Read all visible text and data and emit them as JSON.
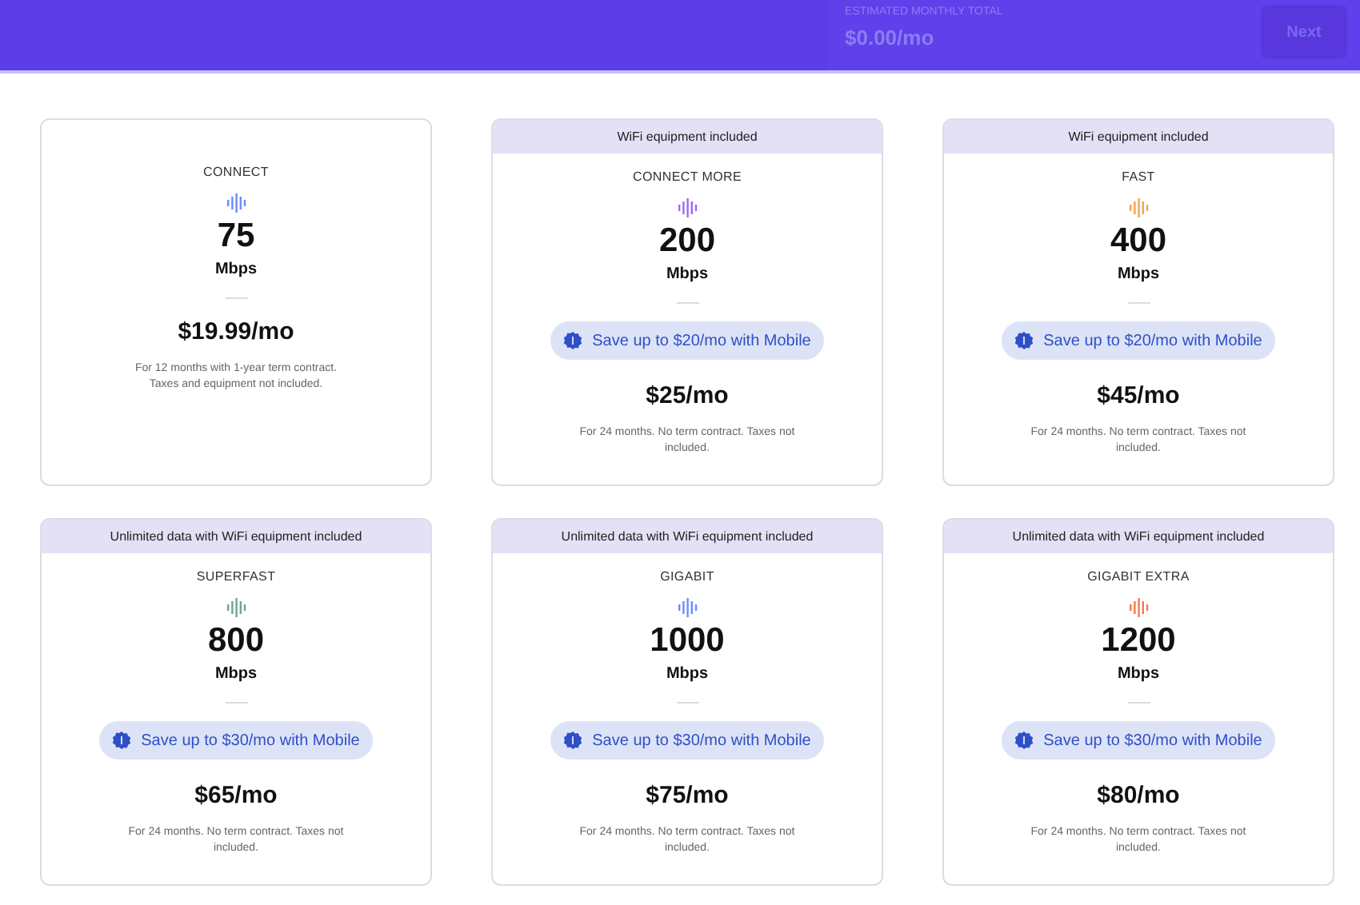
{
  "header": {
    "total_label": "ESTIMATED MONTHLY TOTAL",
    "total": "$0.00/mo",
    "next_button": {
      "label": "Next",
      "disabled": true
    }
  },
  "plans": [
    {
      "name": "CONNECT",
      "color": "#6b8cff",
      "speed": "75",
      "unit": "Mbps",
      "price": "$19.99/mo",
      "note": "For 12 months with 1-year term contract. Taxes and equipment not included."
    },
    {
      "banner": "WiFi equipment included",
      "name": "CONNECT MORE",
      "color": "#9a6cf0",
      "speed": "200",
      "unit": "Mbps",
      "promo": "Save up to $20/mo with Mobile",
      "price": "$25/mo",
      "note": "For 24 months. No term contract. Taxes not included."
    },
    {
      "banner": "WiFi equipment included",
      "name": "FAST",
      "color": "#f0a850",
      "speed": "400",
      "unit": "Mbps",
      "promo": "Save up to $20/mo with Mobile",
      "price": "$45/mo",
      "note": "For 24 months. No term contract. Taxes not included."
    },
    {
      "banner": "Unlimited data with WiFi equipment included",
      "name": "SUPERFAST",
      "color": "#6aa888",
      "speed": "800",
      "unit": "Mbps",
      "promo": "Save up to $30/mo with Mobile",
      "price": "$65/mo",
      "note": "For 24 months. No term contract. Taxes not included."
    },
    {
      "banner": "Unlimited data with WiFi equipment included",
      "name": "GIGABIT",
      "color": "#6b8cff",
      "speed": "1000",
      "unit": "Mbps",
      "promo": "Save up to $30/mo with Mobile",
      "price": "$75/mo",
      "note": "For 24 months. No term contract. Taxes not included."
    },
    {
      "banner": "Unlimited data with WiFi equipment included",
      "name": "GIGABIT EXTRA",
      "color": "#f07a55",
      "speed": "1200",
      "unit": "Mbps",
      "promo": "Save up to $30/mo with Mobile",
      "price": "$80/mo",
      "note": "For 24 months. No term contract. Taxes not included."
    }
  ]
}
